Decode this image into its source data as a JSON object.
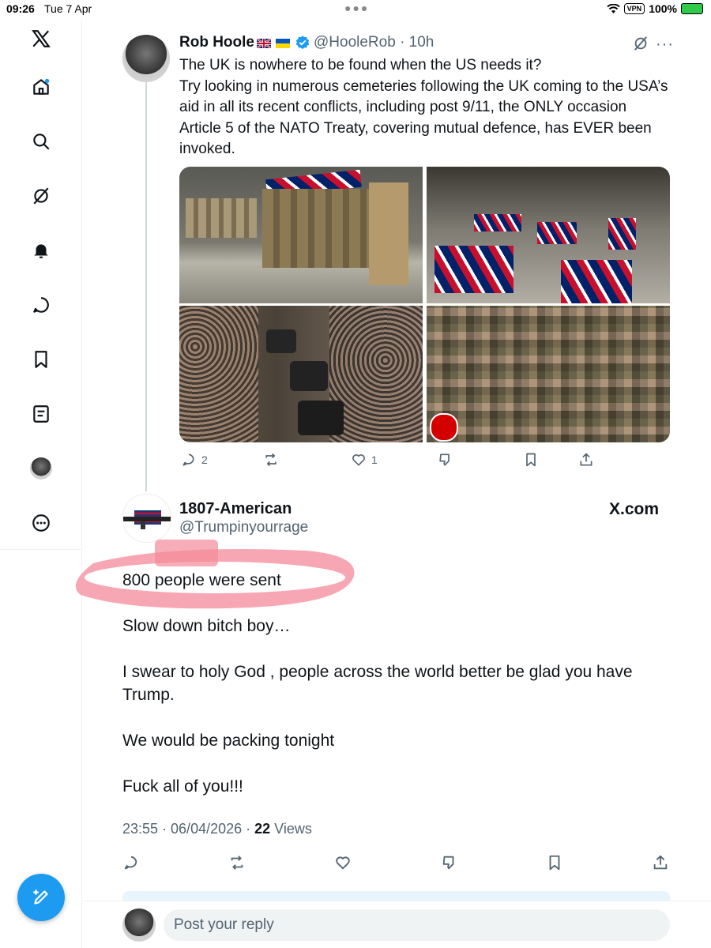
{
  "status_bar": {
    "time": "09:26",
    "date": "Tue 7 Apr",
    "vpn": "VPN",
    "battery": "100%"
  },
  "sidebar": {
    "items": [
      {
        "icon": "x-logo-icon"
      },
      {
        "icon": "home-icon"
      },
      {
        "icon": "search-icon"
      },
      {
        "icon": "grok-icon"
      },
      {
        "icon": "notifications-bell-icon"
      },
      {
        "icon": "messages-icon"
      },
      {
        "icon": "bookmarks-icon"
      },
      {
        "icon": "lists-icon"
      },
      {
        "icon": "profile-avatar"
      },
      {
        "icon": "more-icon"
      }
    ],
    "compose_icon": "compose-post-icon",
    "accent": "#1d9bf0"
  },
  "quoted_tweet": {
    "author_name": "Rob Hoole",
    "handle_time": "@HooleRob · 10h",
    "text_lines": [
      "The UK is nowhere to be found when the US needs it?",
      "Try looking in numerous cemeteries following the UK coming to the USA’s aid in all its recent conflicts, including post 9/11, the ONLY occasion Article 5 of the NATO Treaty, covering mutual defence, has EVER been invoked."
    ],
    "actions": {
      "replies": "2",
      "reposts": "",
      "likes": "1"
    }
  },
  "main_tweet": {
    "author_name": "1807-American",
    "handle": "@Trumpinyourrage",
    "brand": "X.com",
    "paragraphs": [
      "800 people were sent",
      "Slow down bitch boy…",
      "I swear to holy God ,  people across the world better be glad you have Trump.",
      "We would be packing tonight",
      "Fuck all of you!!!"
    ],
    "timestamp": "23:55 · 06/04/2026 · ",
    "views_count": "22",
    "views_label": " Views",
    "highlight_color": "#f48a9a"
  },
  "reply_box": {
    "placeholder": "Post your reply"
  }
}
